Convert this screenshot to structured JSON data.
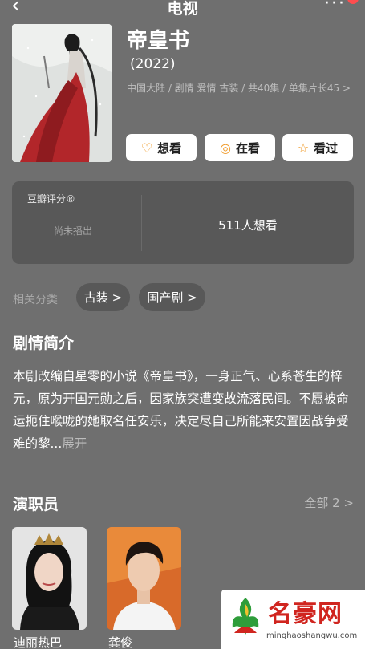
{
  "header": {
    "back_icon": "chevron-left-icon",
    "title": "电视",
    "more_icon": "more-dots-icon"
  },
  "show": {
    "title": "帝皇书",
    "year": "(2022)",
    "meta": "中国大陆 / 剧情 爱情 古装 / 共40集 / 单集片长45 >"
  },
  "actions": [
    {
      "label": "想看",
      "icon": "heart-plus-icon"
    },
    {
      "label": "在看",
      "icon": "target-icon"
    },
    {
      "label": "看过",
      "icon": "star-icon"
    }
  ],
  "rating": {
    "label": "豆瓣评分®",
    "status": "尚未播出",
    "want_count": "511人想看"
  },
  "related": {
    "label": "相关分类",
    "tags": [
      "古装 >",
      "国产剧 >"
    ]
  },
  "synopsis": {
    "title": "剧情简介",
    "text": "本剧改编自星零的小说《帝皇书》，一身正气、心系苍生的梓元，原为开国元勋之后，因家族突遭变故流落民间。不愿被命运扼住喉咙的她取名任安乐，决定尽自己所能来安置因战争受难的黎...",
    "expand": "展开"
  },
  "cast": {
    "title": "演职员",
    "all_label": "全部 2 >",
    "members": [
      {
        "name": "迪丽热巴"
      },
      {
        "name": "龚俊"
      }
    ]
  },
  "watermark": {
    "name": "名豪网",
    "url": "minghaoshangwu.com"
  },
  "colors": {
    "background": "#6f6f6f",
    "card": "#585858",
    "accent": "#f09a28",
    "badge": "#ff4d4f",
    "watermark_red": "#d0251f"
  }
}
